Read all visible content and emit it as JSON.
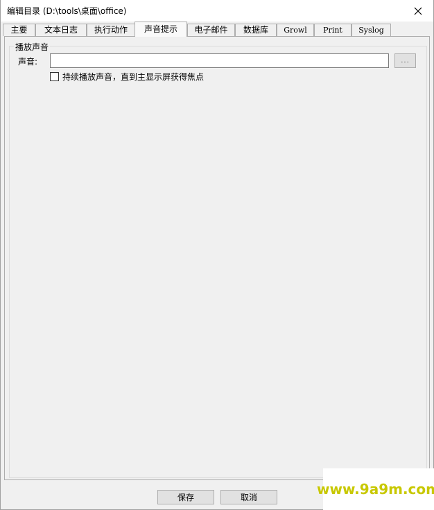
{
  "window": {
    "title": "编辑目录 (D:\\tools\\桌面\\office)"
  },
  "tabs": [
    {
      "label": "主要"
    },
    {
      "label": "文本日志"
    },
    {
      "label": "执行动作"
    },
    {
      "label": "声音提示"
    },
    {
      "label": "电子邮件"
    },
    {
      "label": "数据库"
    },
    {
      "label": "Growl"
    },
    {
      "label": "Print"
    },
    {
      "label": "Syslog"
    }
  ],
  "active_tab": "声音提示",
  "sound_group": {
    "legend": "播放声音",
    "sound_label": "声音:",
    "sound_value": "",
    "browse_label": "...",
    "loop_checkbox_label": "持续播放声音，直到主显示屏获得焦点",
    "loop_checked": false
  },
  "buttons": {
    "save": "保存",
    "cancel": "取消"
  },
  "watermark": "www.9a9m.com"
}
